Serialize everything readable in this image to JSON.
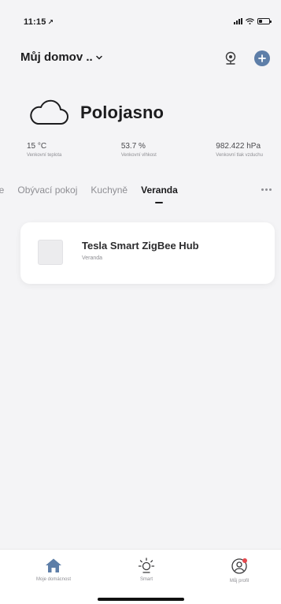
{
  "status_bar": {
    "time": "11:15",
    "location_glyph": "↗",
    "icons": [
      "signal-icon",
      "wifi-icon",
      "battery-icon"
    ]
  },
  "header": {
    "home_name": "Můj domov ..",
    "icons": [
      "camera-icon",
      "add-circle-icon"
    ],
    "accent_color": "#5d7ea8"
  },
  "weather": {
    "icon": "cloud-icon",
    "condition": "Polojasno",
    "stats": [
      {
        "value": "15 °C",
        "label": "Venkovní teplota"
      },
      {
        "value": "53.7 %",
        "label": "Venkovní vlhkost"
      },
      {
        "value": "982.422 hPa",
        "label": "Venkovní tlak vzduchu"
      }
    ]
  },
  "tabs": {
    "items": [
      {
        "label": "ace",
        "active": false
      },
      {
        "label": "Obývací pokoj",
        "active": false
      },
      {
        "label": "Kuchyně",
        "active": false
      },
      {
        "label": "Veranda",
        "active": true
      }
    ],
    "more_icon": "more-dots-icon"
  },
  "devices": [
    {
      "name": "Tesla Smart ZigBee Hub",
      "room": "Veranda"
    }
  ],
  "bottom_nav": {
    "items": [
      {
        "label": "Moje domácnost",
        "icon": "home-icon",
        "active": true
      },
      {
        "label": "Smart",
        "icon": "sun-icon",
        "active": false
      },
      {
        "label": "Můj profil",
        "icon": "profile-icon",
        "active": false
      }
    ],
    "badge_color": "#e5484d"
  }
}
